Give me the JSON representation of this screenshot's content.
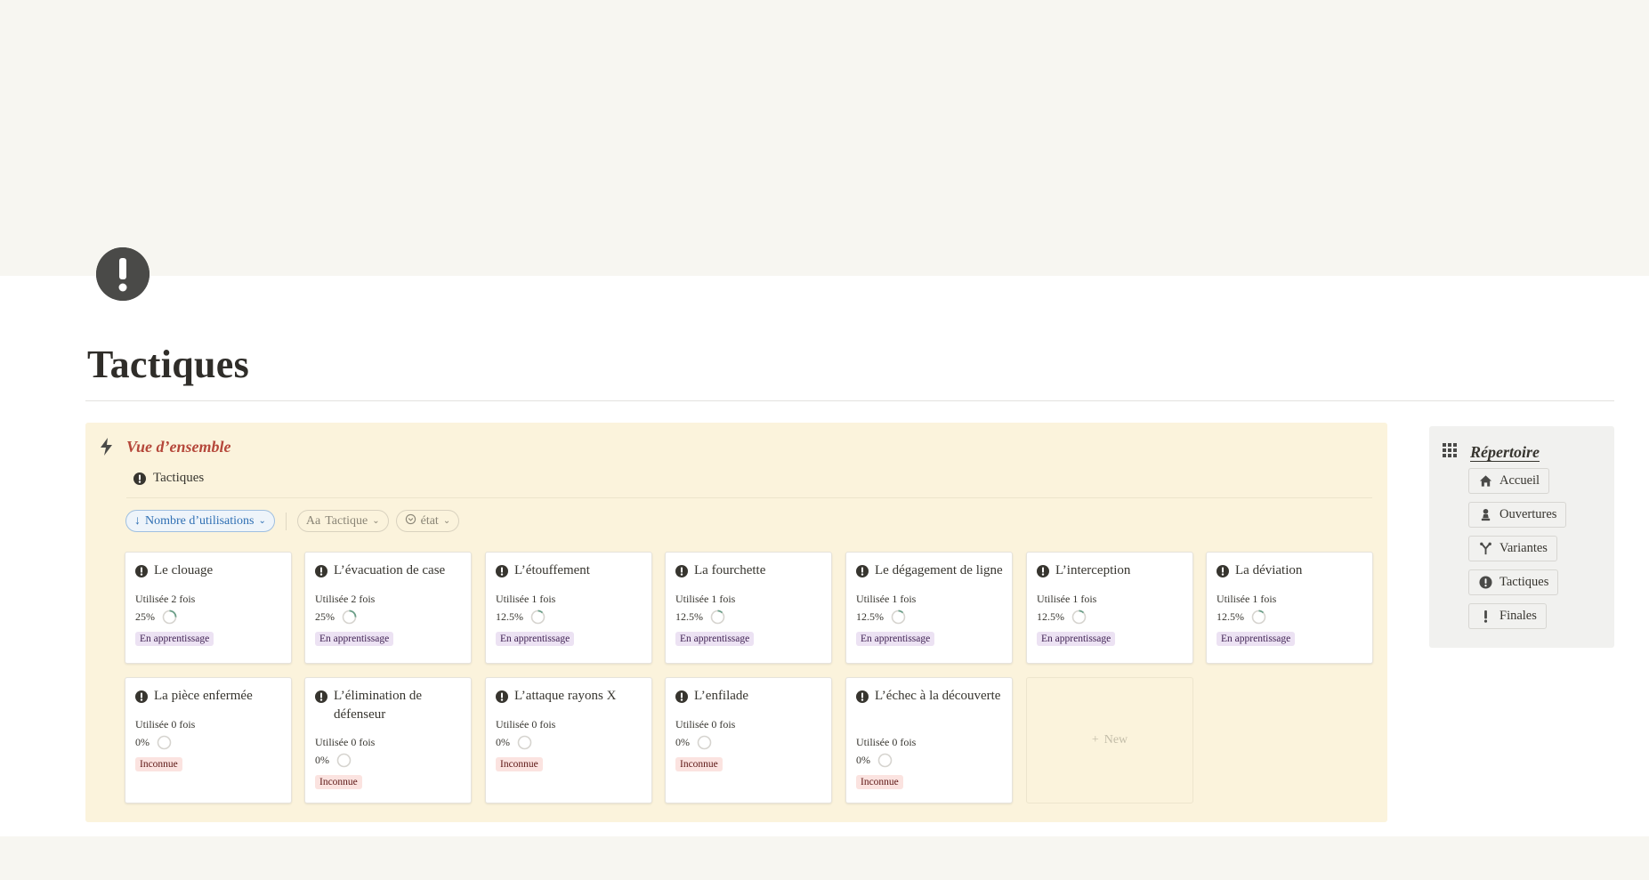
{
  "page": {
    "title": "Tactiques",
    "icon": "exclamation-circle-icon"
  },
  "callout": {
    "title": "Vue d’ensemble",
    "icon": "lightning-bolt-icon",
    "database_title": "Tactiques",
    "filters": {
      "sort_label": "Nombre d’utilisations",
      "property_1_prefix": "Aa",
      "property_1": "Tactique",
      "property_2": "état"
    },
    "cards": [
      {
        "title": "Le clouage",
        "uses": "Utilisée 2 fois",
        "percent": "25%",
        "progress": 0.25,
        "tag": "En apprentissage",
        "tag_type": "learn"
      },
      {
        "title": "L’évacuation de case",
        "uses": "Utilisée 2 fois",
        "percent": "25%",
        "progress": 0.25,
        "tag": "En apprentissage",
        "tag_type": "learn"
      },
      {
        "title": "L’étouffement",
        "uses": "Utilisée 1 fois",
        "percent": "12.5%",
        "progress": 0.125,
        "tag": "En apprentissage",
        "tag_type": "learn"
      },
      {
        "title": "La fourchette",
        "uses": "Utilisée 1 fois",
        "percent": "12.5%",
        "progress": 0.125,
        "tag": "En apprentissage",
        "tag_type": "learn"
      },
      {
        "title": "Le dégagement de ligne",
        "uses": "Utilisée 1 fois",
        "percent": "12.5%",
        "progress": 0.125,
        "tag": "En apprentissage",
        "tag_type": "learn"
      },
      {
        "title": "L’interception",
        "uses": "Utilisée 1 fois",
        "percent": "12.5%",
        "progress": 0.125,
        "tag": "En apprentissage",
        "tag_type": "learn"
      },
      {
        "title": "La déviation",
        "uses": "Utilisée 1 fois",
        "percent": "12.5%",
        "progress": 0.125,
        "tag": "En apprentissage",
        "tag_type": "learn"
      },
      {
        "title": "La pièce enfermée",
        "uses": "Utilisée 0 fois",
        "percent": "0%",
        "progress": 0,
        "tag": "Inconnue",
        "tag_type": "unknown"
      },
      {
        "title": "L’élimination de défenseur",
        "uses": "Utilisée 0 fois",
        "percent": "0%",
        "progress": 0,
        "tag": "Inconnue",
        "tag_type": "unknown"
      },
      {
        "title": "L’attaque rayons X",
        "uses": "Utilisée 0 fois",
        "percent": "0%",
        "progress": 0,
        "tag": "Inconnue",
        "tag_type": "unknown"
      },
      {
        "title": "L’enfilade",
        "uses": "Utilisée 0 fois",
        "percent": "0%",
        "progress": 0,
        "tag": "Inconnue",
        "tag_type": "unknown"
      },
      {
        "title": "L’échec à la découverte",
        "uses": "Utilisée 0 fois",
        "percent": "0%",
        "progress": 0,
        "tag": "Inconnue",
        "tag_type": "unknown"
      }
    ],
    "new_label": "New"
  },
  "directory": {
    "title": "Répertoire",
    "icon": "grid-icon",
    "links": [
      {
        "label": "Accueil",
        "icon": "home-icon"
      },
      {
        "label": "Ouvertures",
        "icon": "chess-pawn-icon"
      },
      {
        "label": "Variantes",
        "icon": "branch-icon"
      },
      {
        "label": "Tactiques",
        "icon": "exclamation-circle-icon"
      },
      {
        "label": "Finales",
        "icon": "exclamation-icon"
      }
    ]
  },
  "colors": {
    "callout_bg": "#fbf3dc",
    "callout_title": "#b5473a",
    "sort_chip": "#2f6fb3",
    "tag_learn_bg": "#ece2f3",
    "tag_unknown_bg": "#fbe3e0",
    "progress_ring": "#6b9e88"
  }
}
